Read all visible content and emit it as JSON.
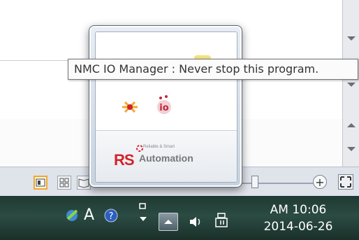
{
  "tooltip": {
    "text": "NMC IO Manager : Never stop this program."
  },
  "popup": {
    "logo_rs": "RS",
    "logo_automation": "Automation",
    "logo_tagline": "Reliable & Smart",
    "icons": [
      "app-icon-green",
      "app-icon-yellow",
      "network-icon",
      "io-manager-icon"
    ]
  },
  "taskbar": {
    "tray": [
      "network-status-icon",
      "ime-icon",
      "help-icon",
      "pen-flick-icon",
      "show-hidden-icons",
      "volume-icon",
      "power-icon"
    ],
    "ime_label": "A",
    "help_label": "?",
    "clock_time": "AM  10:06",
    "clock_date": "2014-06-26"
  },
  "statusbar": {
    "zoom_plus_label": "+",
    "active_view": "print-layout"
  },
  "colors": {
    "taskbar": "#2b4b43",
    "accent": "#f0a830",
    "brand_red": "#d2232a"
  }
}
